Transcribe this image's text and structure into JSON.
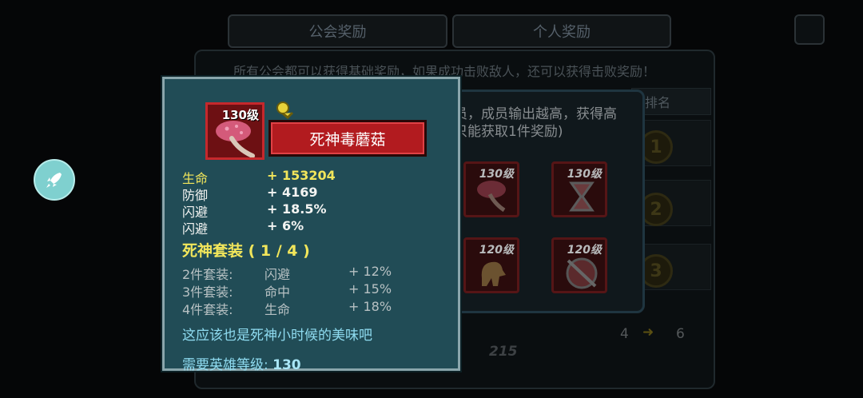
{
  "tabs": {
    "guild_rewards": "公会奖励",
    "personal_rewards": "个人奖励"
  },
  "background": {
    "notice": "所有公会都可以获得基础奖励，如果成功击败敌人，还可以获得击败奖励！",
    "rank_header": "排名",
    "reward_desc_line1": "员，成员输出越高，获得高",
    "reward_desc_line2": "只能获取1件奖励)",
    "reward_items": [
      {
        "level": "130级",
        "icon": "mushroom-icon"
      },
      {
        "level": "130级",
        "icon": "hourglass-icon"
      },
      {
        "level": "120级",
        "icon": "horse-toy-icon"
      },
      {
        "level": "120级",
        "icon": "shield-icon"
      }
    ],
    "medals": [
      "1",
      "2",
      "3"
    ],
    "bottom_count": "215",
    "bottom_from": "4",
    "bottom_to": "6"
  },
  "tooltip": {
    "item_level": "130级",
    "item_name": "死神毒蘑菇",
    "item_icon": "mushroom-icon",
    "stats": [
      {
        "label": "生命",
        "value": "+ 153204",
        "highlight": true
      },
      {
        "label": "防御",
        "value": "+ 4169",
        "highlight": false
      },
      {
        "label": "闪避",
        "value": "+ 18.5%",
        "highlight": false
      },
      {
        "label": "闪避",
        "value": "+ 6%",
        "highlight": false
      }
    ],
    "set_title": "死神套装 ( 1 / 4 )",
    "set_bonuses": [
      {
        "pieces": "2件套装:",
        "stat": "闪避",
        "value": "+ 12%"
      },
      {
        "pieces": "3件套装:",
        "stat": "命中",
        "value": "+ 15%"
      },
      {
        "pieces": "4件套装:",
        "stat": "生命",
        "value": "+ 18%"
      }
    ],
    "flavor_text": "这应该也是死神小时候的美味吧",
    "requirement_label": "需要英雄等级:",
    "requirement_value": "130"
  },
  "colors": {
    "tooltip_bg": "#214c56",
    "banner_red": "#b21b1f",
    "gold_text": "#f2e65b",
    "cyan_text": "#8fdcf1"
  }
}
